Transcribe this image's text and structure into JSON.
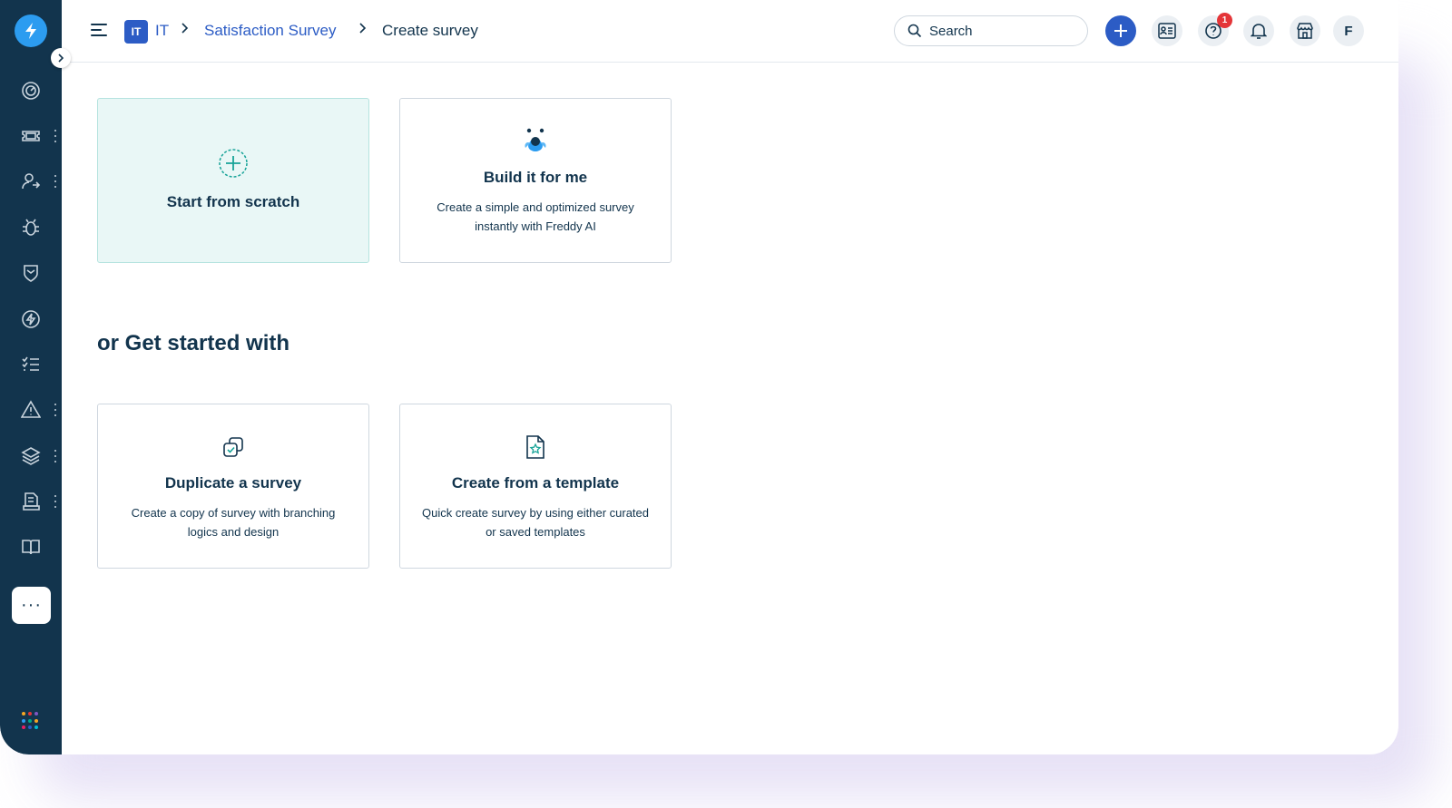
{
  "header": {
    "workspace_badge": "IT",
    "breadcrumb": [
      "IT",
      "Satisfaction Survey",
      "Create survey"
    ],
    "search_placeholder": "Search",
    "help_notification_count": "1",
    "avatar_initial": "F"
  },
  "sidebar": {
    "more_label": "···",
    "icons": [
      "dashboard-icon",
      "tickets-icon",
      "contacts-icon",
      "problems-icon",
      "changes-icon",
      "releases-icon",
      "tasks-icon",
      "alerts-icon",
      "assets-icon",
      "reports-icon",
      "solutions-icon"
    ]
  },
  "options": {
    "scratch": {
      "title": "Start from scratch"
    },
    "build": {
      "title": "Build it for me",
      "description": "Create a simple and optimized survey instantly with Freddy AI"
    }
  },
  "section": {
    "title": "or Get started with"
  },
  "start_options": {
    "duplicate": {
      "title": "Duplicate a survey",
      "description": "Create a copy of survey with branching logics and design"
    },
    "template": {
      "title": "Create from a template",
      "description": "Quick create survey by using either curated or saved templates"
    }
  },
  "colors": {
    "sidebar": "#12344d",
    "primary": "#2c5cc5",
    "accent_teal": "#17a398",
    "selected_card_bg": "#e9f7f6",
    "badge_red": "#e43538"
  }
}
